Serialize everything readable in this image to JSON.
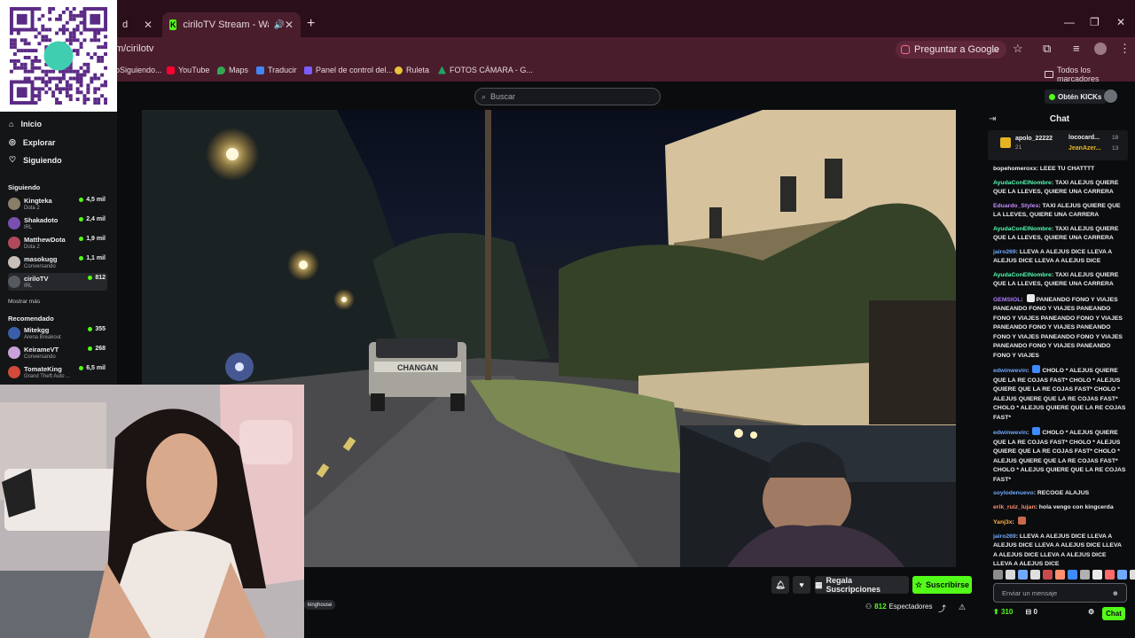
{
  "browser": {
    "tabs": [
      {
        "label": "d"
      },
      {
        "label": "ciriloTV Stream - Watch Live",
        "favicon": "K"
      }
    ],
    "new_tab_icon": "plus-icon",
    "url": "m/cirilotv",
    "google_button": "Preguntar a Google",
    "bookmarks": [
      {
        "label": "oSiguiendo..."
      },
      {
        "label": "YouTube",
        "color": "#ff0033"
      },
      {
        "label": "Maps",
        "color": "#34a853"
      },
      {
        "label": "Traducir",
        "color": "#4285f4"
      },
      {
        "label": "Panel de control del...",
        "color": "#7b5cff"
      },
      {
        "label": "Ruleta",
        "color": "#e7c33a"
      },
      {
        "label": "FOTOS CÁMARA - G...",
        "color": "#1fa463"
      }
    ],
    "all_bookmarks": "Todos los marcadores"
  },
  "header": {
    "search_placeholder": "Buscar",
    "kicks_button": "Obtén KICKs"
  },
  "sidebar": {
    "nav": [
      {
        "label": "Inicio",
        "icon": "home-icon"
      },
      {
        "label": "Explorar",
        "icon": "compass-icon"
      },
      {
        "label": "Siguiendo",
        "icon": "heart-icon"
      }
    ],
    "following_title": "Siguiendo",
    "following": [
      {
        "name": "Kingteka",
        "category": "Dota 2",
        "viewers": "4,5 mil",
        "color": "#8a7d6a"
      },
      {
        "name": "Shakadoto",
        "category": "IRL",
        "viewers": "2,4 mil",
        "color": "#7a4fb0"
      },
      {
        "name": "MatthewDota",
        "category": "Dota 2",
        "viewers": "1,9 mil",
        "color": "#b04a5a"
      },
      {
        "name": "masokugg",
        "category": "Conversando",
        "viewers": "1,1 mil",
        "color": "#c8c0b8"
      },
      {
        "name": "ciriloTV",
        "category": "IRL",
        "viewers": "812",
        "color": "#555a60"
      }
    ],
    "show_more": "Mostrar más",
    "recommended_title": "Recomendado",
    "recommended": [
      {
        "name": "Mitekgg",
        "category": "Arena Breakout",
        "viewers": "355",
        "color": "#3a5ea8"
      },
      {
        "name": "KeirameVT",
        "category": "Conversando",
        "viewers": "268",
        "color": "#c8a2d8"
      },
      {
        "name": "TomateKing",
        "category": "Grand Theft Auto ...",
        "viewers": "6,5 mil",
        "color": "#d14a3a"
      }
    ]
  },
  "stream": {
    "truck_text": "CHANGAN",
    "tag": "kinghouse",
    "gift_button": "Regala Suscripciones",
    "subscribe_button": "Suscribirse",
    "viewers_count": "812",
    "viewers_label": "Espectadores"
  },
  "chat": {
    "title": "Chat",
    "leaderboard": [
      {
        "name": "apolo_22222",
        "count": "21",
        "color": "#e6b422"
      },
      {
        "name": "lococard...",
        "count": "18",
        "color": "#efeff1"
      },
      {
        "name": "JeanAzer...",
        "count": "13",
        "color": "#e6b422"
      }
    ],
    "messages": [
      {
        "user": "bopehomeroxx",
        "color": "#efeff1",
        "text": "LEEE TU CHATTTT"
      },
      {
        "user": "AyudaConElNombre",
        "color": "#53fcb0",
        "text": "TAXI ALEJUS QUIERE QUE LA LLEVES, QUIERE UNA CARRERA"
      },
      {
        "user": "Eduardo_Styles",
        "color": "#c78bff",
        "text": "TAXI ALEJUS QUIERE QUE LA LLEVES, QUIERE UNA CARRERA"
      },
      {
        "user": "AyudaConElNombre",
        "color": "#53fcb0",
        "text": "TAXI ALEJUS QUIERE QUE LA LLEVES, QUIERE UNA CARRERA"
      },
      {
        "user": "jairo269",
        "color": "#6fa8ff",
        "text": "LLEVA A ALEJUS DICE LLEVA A ALEJUS DICE LLEVA A ALEJUS DICE"
      },
      {
        "user": "AyudaConElNombre",
        "color": "#53fcb0",
        "text": "TAXI ALEJUS QUIERE QUE LA LLEVES, QUIERE UNA CARRERA"
      },
      {
        "user": "GEMSIOL",
        "color": "#b07cff",
        "text": "PANEANDO FONO Y VIAJES PANEANDO FONO Y VIAJES PANEANDO FONO Y VIAJES PANEANDO FONO Y VIAJES PANEANDO FONO Y VIAJES PANEANDO FONO Y VIAJES PANEANDO FONO Y VIAJES PANEANDO FONO Y VIAJES PANEANDO FONO Y VIAJES",
        "emote": "#e9e9e9"
      },
      {
        "user": "edwinwevin",
        "color": "#6fa8ff",
        "text": "CHOLO * ALEJUS QUIERE QUE LA RE COJAS FAST* CHOLO * ALEJUS QUIERE QUE LA RE COJAS FAST* CHOLO * ALEJUS QUIERE QUE LA RE COJAS FAST* CHOLO * ALEJUS QUIERE QUE LA RE COJAS FAST*",
        "emote": "#3d8bff"
      },
      {
        "user": "edwinwevin",
        "color": "#6fa8ff",
        "text": "CHOLO * ALEJUS QUIERE QUE LA RE COJAS FAST* CHOLO * ALEJUS QUIERE QUE LA RE COJAS FAST* CHOLO * ALEJUS QUIERE QUE LA RE COJAS FAST* CHOLO * ALEJUS QUIERE QUE LA RE COJAS FAST*",
        "emote": "#3d8bff"
      },
      {
        "user": "soylodenuevo",
        "color": "#6fa8ff",
        "text": "RECOGE ALAJUS"
      },
      {
        "user": "erik_ruiz_lujan",
        "color": "#ff8f6f",
        "text": "hola vengo con kingcerda"
      },
      {
        "user": "Yanj3x",
        "color": "#ffb347",
        "text": "",
        "emote": "#c86a4a"
      },
      {
        "user": "jairo269",
        "color": "#6fa8ff",
        "text": "LLEVA A ALEJUS DICE LLEVA A ALEJUS DICE LLEVA A ALEJUS DICE LLEVA A ALEJUS DICE LLEVA A ALEJUS DICE LLEVA A ALEJUS DICE"
      }
    ],
    "input_placeholder": "Enviar un mensaje",
    "kicks_count": "310",
    "gift_count": "0",
    "send_button": "Chat"
  }
}
